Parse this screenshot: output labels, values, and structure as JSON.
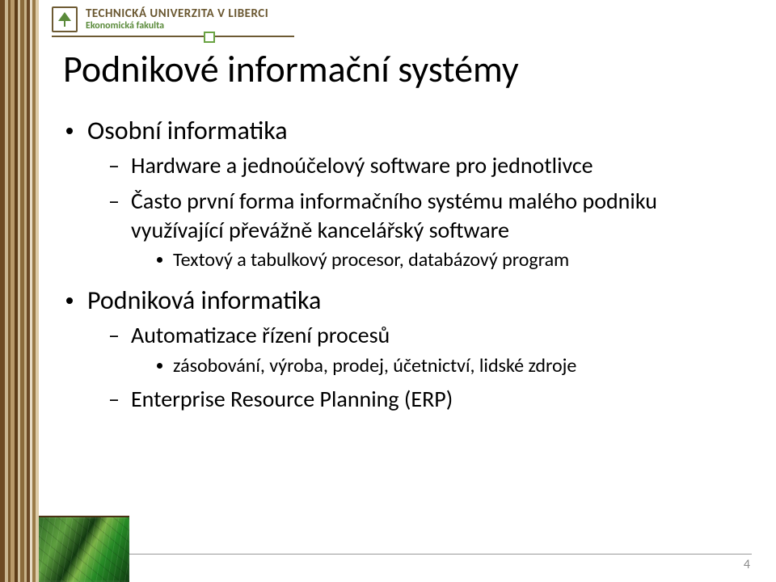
{
  "header": {
    "university_line1": "TECHNICKÁ UNIVERZITA V LIBERCI",
    "university_line2": "Ekonomická fakulta"
  },
  "title": "Podnikové informační systémy",
  "bullets": [
    {
      "text": "Osobní informatika",
      "children": [
        {
          "text": "Hardware a jednoúčelový software pro jednotlivce"
        },
        {
          "text": "Často první forma informačního systému malého podniku využívající převážně kancelářský software",
          "children": [
            {
              "text": "Textový a tabulkový procesor, databázový program"
            }
          ]
        }
      ]
    },
    {
      "text": "Podniková informatika",
      "children": [
        {
          "text": "Automatizace řízení procesů",
          "children": [
            {
              "text": "zásobování, výroba, prodej, účetnictví, lidské zdroje"
            }
          ]
        },
        {
          "text": "Enterprise Resource Planning (ERP)"
        }
      ]
    }
  ],
  "page_number": "4"
}
